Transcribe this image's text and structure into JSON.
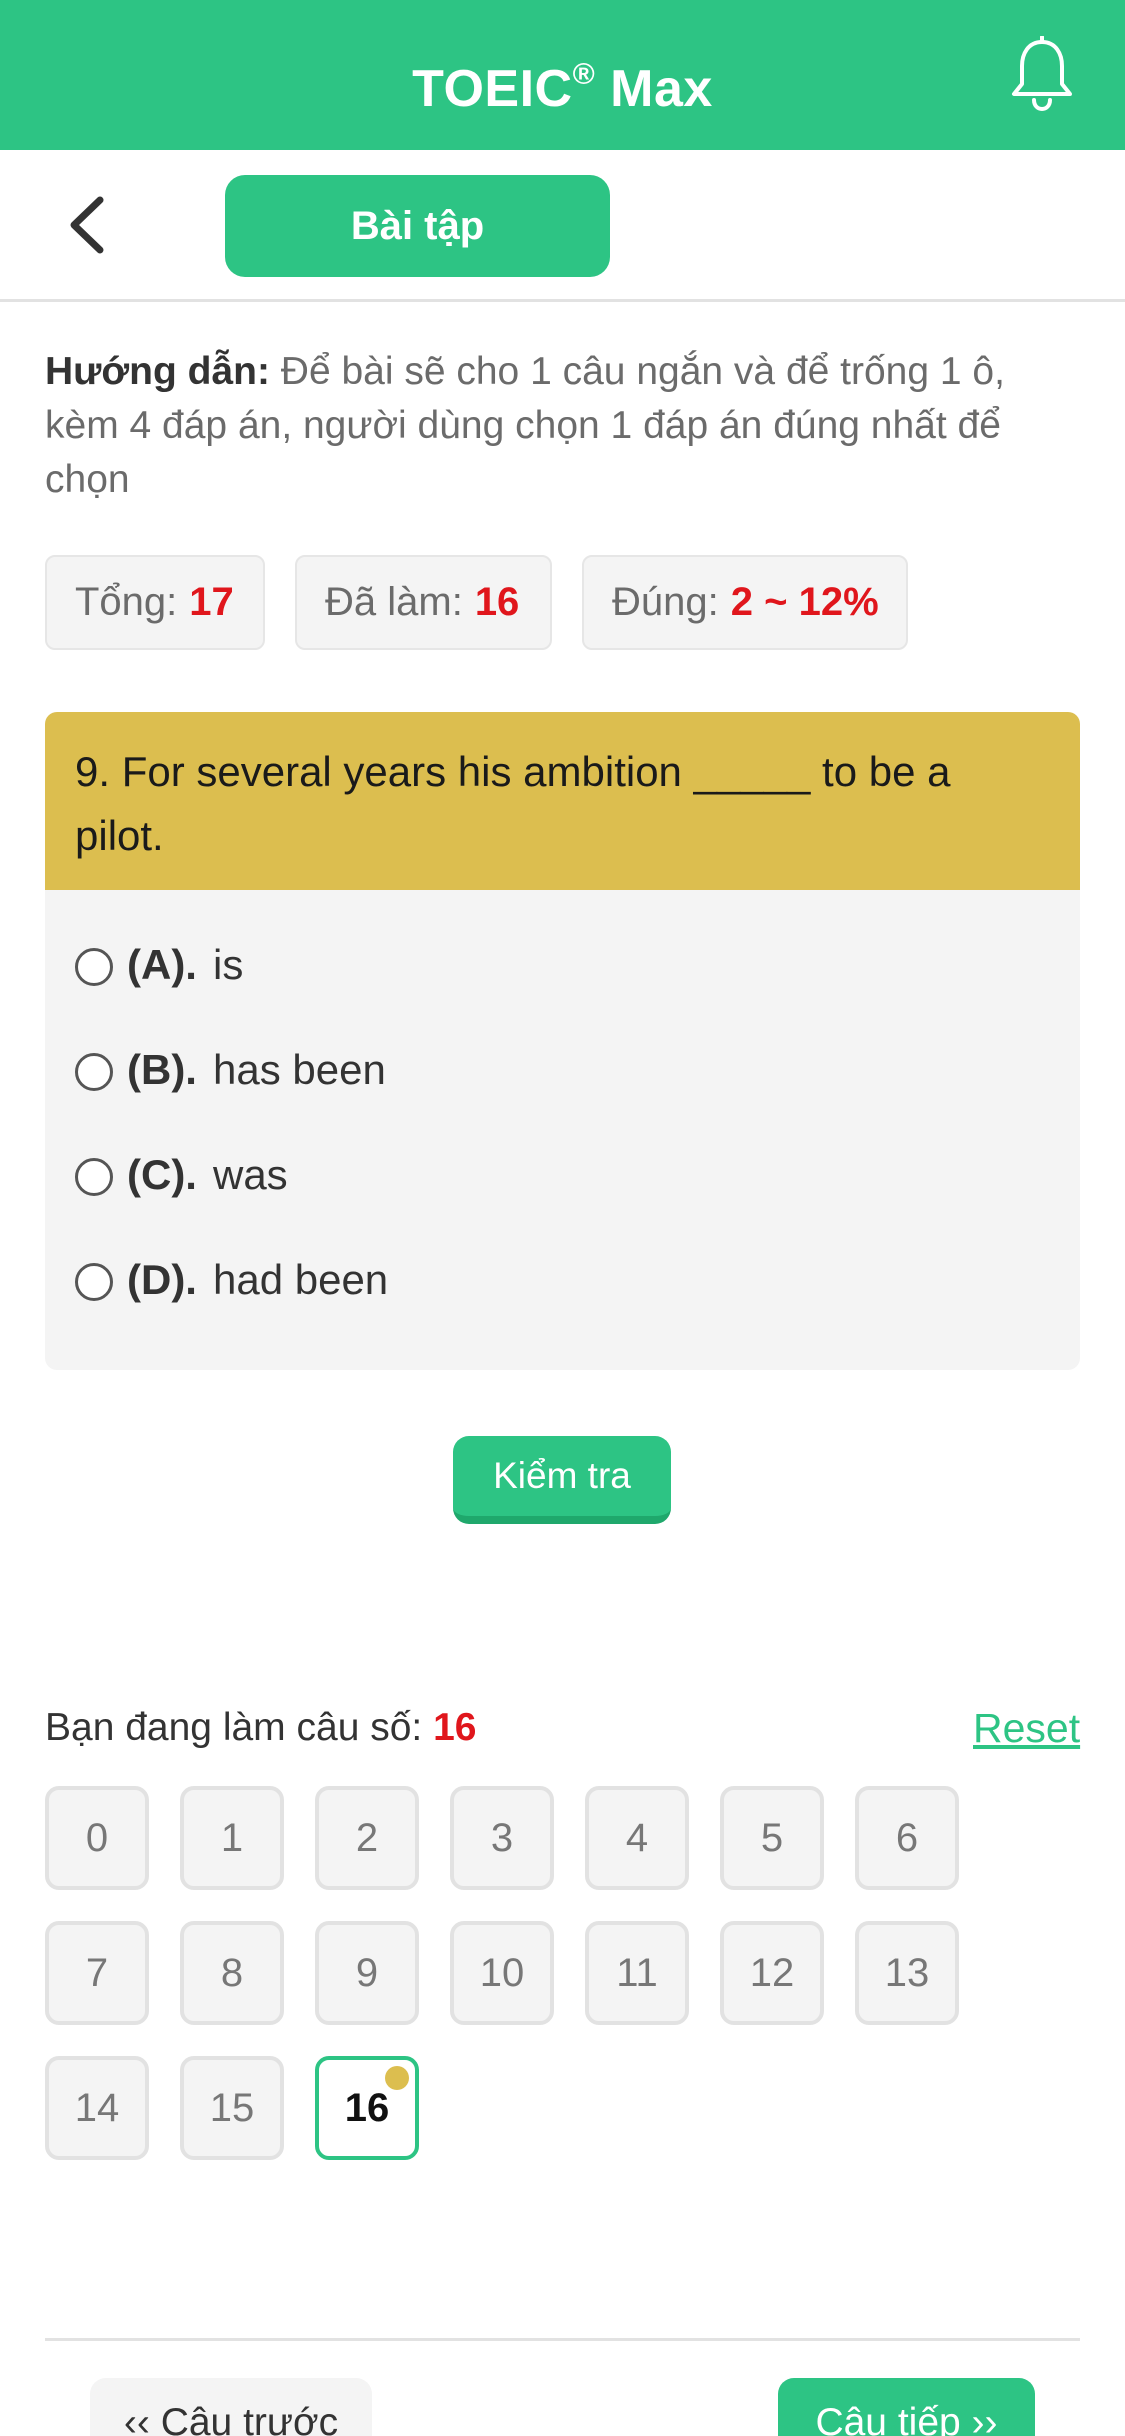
{
  "header": {
    "title": "TOEIC",
    "title_mark": "®",
    "title_suffix": " Max",
    "bell_icon": "bell-icon",
    "background": "#2dc484"
  },
  "subbar": {
    "back_icon": "chevron-left-icon",
    "tab_label": "Bài tập"
  },
  "instruction": {
    "label": "Hướng dẫn:",
    "text": " Để bài sẽ cho 1 câu ngắn và để trống 1 ô, kèm 4 đáp án, người dùng chọn 1 đáp án đúng nhất để chọn"
  },
  "stats": {
    "total_label": "Tổng:",
    "total_value": "17",
    "done_label": "Đã làm:",
    "done_value": "16",
    "correct_label": "Đúng:",
    "correct_value": "2 ~ 12%"
  },
  "question": {
    "text": "9. For several years his ambition _____ to be a pilot.",
    "options": [
      {
        "letter": "(A).",
        "text": "is"
      },
      {
        "letter": "(B).",
        "text": "has been"
      },
      {
        "letter": "(C).",
        "text": "was"
      },
      {
        "letter": "(D).",
        "text": "had been"
      }
    ]
  },
  "check_button": "Kiểm tra",
  "progress": {
    "label": "Bạn đang làm câu số: ",
    "current": "16",
    "reset": "Reset",
    "numbers": [
      "0",
      "1",
      "2",
      "3",
      "4",
      "5",
      "6",
      "7",
      "8",
      "9",
      "10",
      "11",
      "12",
      "13",
      "14",
      "15",
      "16"
    ]
  },
  "nav": {
    "prev": "‹‹ Câu trước",
    "next": "Câu tiếp ››"
  },
  "colors": {
    "accent": "#2dc484",
    "question_header": "#dcbe4f",
    "highlight_number": "#e0161c"
  }
}
